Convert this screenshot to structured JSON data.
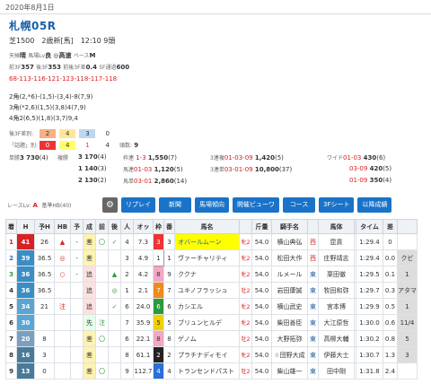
{
  "header": {
    "date": "2020年8月1日"
  },
  "race": {
    "title": "札幌05R",
    "info": "芝1500　2歳新[馬]　12:10 9頭",
    "weather_line": {
      "tenki_label": "天候",
      "tenki": "晴",
      "baba_label": "馬場Lv",
      "baba": "良",
      "baba_mark": "◎",
      "speed": "高速",
      "pace_label": "ペース",
      "pace": "M"
    },
    "time_line": {
      "zen3f_label": "前3F",
      "zen3f": "357",
      "kou3f_label": "後3F",
      "kou3f": "353",
      "diff_label": "前後3F差",
      "diff": "0.4",
      "f5_label": "5F通過",
      "f5": "600"
    },
    "laps": "68-113-116-121-123-118-117-118",
    "corners": [
      "2角(2,*6)-(1,5)-(3,4)-8(7,9)",
      "3角(*2,6)(1,5)(3,8)4(7,9)",
      "4角2(6,5)(1,8)(3,7)9,4"
    ],
    "kyaku": {
      "label": "後3F差別:",
      "values": [
        "2",
        "4",
        "3",
        "0"
      ]
    },
    "shiro": {
      "label": "「話題」別:",
      "values": [
        "0",
        "4",
        "1",
        "4"
      ],
      "count_label": "頭数:",
      "count": "9"
    }
  },
  "payouts": {
    "tansho": {
      "label": "単勝",
      "num": "3",
      "pay": "730",
      "pop": "(4)"
    },
    "fukusho_label": "複勝",
    "fukusho": [
      {
        "num": "3",
        "pay": "170",
        "pop": "(4)"
      },
      {
        "num": "1",
        "pay": "140",
        "pop": "(3)"
      },
      {
        "num": "2",
        "pay": "130",
        "pop": "(2)"
      }
    ],
    "wakuren": {
      "label": "枠連",
      "num": "1-3",
      "pay": "1,550",
      "pop": "(7)"
    },
    "umaren": {
      "label": "馬連",
      "num": "01-03",
      "pay": "1,120",
      "pop": "(5)"
    },
    "umatan": {
      "label": "馬単",
      "num": "03-01",
      "pay": "2,860",
      "pop": "(14)"
    },
    "renpuku": {
      "label": "3連複",
      "num": "01-03-09",
      "pay": "1,420",
      "pop": "(5)"
    },
    "rentan": {
      "label": "3連単",
      "num": "03-01-09",
      "pay": "10,800",
      "pop": "(37)"
    },
    "wide_label": "ワイド",
    "wide": [
      {
        "num": "01-03",
        "pay": "430",
        "pop": "(6)"
      },
      {
        "num": "03-09",
        "pay": "420",
        "pop": "(5)"
      },
      {
        "num": "01-09",
        "pay": "350",
        "pop": "(4)"
      }
    ]
  },
  "race_lv": {
    "label": "レースLv:",
    "value": "A",
    "base_label": "基準HB(40)"
  },
  "toolbar": {
    "buttons": [
      "リプレイ",
      "新聞",
      "馬場傾向",
      "開催ビューワ",
      "コース",
      "3Fシート",
      "以降成績"
    ]
  },
  "table": {
    "headers": [
      "着",
      "H",
      "予H",
      "HB",
      "予",
      "成",
      "前",
      "後",
      "人",
      "オッ",
      "枠",
      "番",
      "馬名",
      "",
      "斤量",
      "騎手名",
      "",
      "馬体",
      "",
      "タイム",
      "差",
      ""
    ],
    "rows": [
      {
        "chaku": "1",
        "h": "41",
        "yoh": "26",
        "hb": "▲",
        "yo": "-",
        "sei": "差",
        "mae": "〇",
        "ato": "✓",
        "nin": "4",
        "odds": "7.3",
        "waku": "3",
        "ban": "3",
        "name": "オバールムーン",
        "sex": "牝2",
        "kin": "54.0",
        "jockey": "横山典弘",
        "loc": "西",
        "trainer": "昆貢",
        "time": "1:29.4",
        "sa": "0",
        "extra": ""
      },
      {
        "chaku": "2",
        "h": "39",
        "yoh": "36.5",
        "hb": "◎",
        "yo": "-",
        "sei": "差",
        "mae": "",
        "ato": "",
        "nin": "3",
        "odds": "4.9",
        "waku": "1",
        "ban": "1",
        "name": "ヴァーチャリティ",
        "sex": "牝2",
        "kin": "54.0",
        "jockey": "松田大作",
        "loc": "西",
        "trainer": "庄野靖志",
        "time": "1:29.4",
        "sa": "0.0",
        "extra": "クビ"
      },
      {
        "chaku": "3",
        "h": "36",
        "yoh": "36.5",
        "hb": "○",
        "yo": "-",
        "sei": "追",
        "mae": "",
        "ato": "▲",
        "nin": "2",
        "odds": "4.2",
        "waku": "8",
        "ban": "9",
        "name": "ククナ",
        "sex": "牝2",
        "kin": "54.0",
        "jockey": "ルメール",
        "loc": "東",
        "trainer": "栗田徹",
        "time": "1:29.5",
        "sa": "0.1",
        "extra": "1"
      },
      {
        "chaku": "4",
        "h": "36",
        "yoh": "36.5",
        "hb": "",
        "yo": "",
        "sei": "追",
        "mae": "",
        "ato": "◎",
        "nin": "1",
        "odds": "2.1",
        "waku": "7",
        "ban": "7",
        "name": "ユキノフラッシュ",
        "sex": "牡2",
        "kin": "54.0",
        "jockey": "岩田康誠",
        "loc": "東",
        "trainer": "牧田和弥",
        "time": "1:29.7",
        "sa": "0.3",
        "extra": "アタマ"
      },
      {
        "chaku": "5",
        "h": "34",
        "yoh": "21",
        "hb": "注",
        "yo": "",
        "sei": "追",
        "mae": "",
        "ato": "✓",
        "nin": "6",
        "odds": "24.0",
        "waku": "6",
        "ban": "6",
        "name": "カシエル",
        "sex": "牝2",
        "kin": "54.0",
        "jockey": "横山武史",
        "loc": "東",
        "trainer": "宮本博",
        "time": "1:29.9",
        "sa": "0.5",
        "extra": "1"
      },
      {
        "chaku": "6",
        "h": "30",
        "yoh": "",
        "hb": "",
        "yo": "",
        "sei": "先",
        "mae": "注",
        "ato": "",
        "nin": "7",
        "odds": "35.9",
        "waku": "5",
        "ban": "5",
        "name": "ブリュンヒルデ",
        "sex": "牝2",
        "kin": "54.0",
        "jockey": "柴田善臣",
        "loc": "東",
        "trainer": "大江原哲",
        "time": "1:30.0",
        "sa": "0.6",
        "extra": "11/4"
      },
      {
        "chaku": "7",
        "h": "20",
        "yoh": "8",
        "hb": "",
        "yo": "",
        "sei": "差",
        "mae": "〇",
        "ato": "",
        "nin": "6",
        "odds": "22.1",
        "waku": "8",
        "ban": "8",
        "name": "ゲノム",
        "sex": "牡2",
        "kin": "54.0",
        "jockey": "大野拓弥",
        "loc": "東",
        "trainer": "高柳大輔",
        "time": "1:30.2",
        "sa": "0.8",
        "extra": "5"
      },
      {
        "chaku": "8",
        "h": "16",
        "yoh": "3",
        "hb": "",
        "yo": "",
        "sei": "差",
        "mae": "",
        "ato": "",
        "nin": "8",
        "odds": "61.1",
        "waku": "2",
        "ban": "2",
        "name": "プラチナディモイ",
        "sex": "牝2",
        "kin": "54.0",
        "jockey": "☆団野大成",
        "loc": "東",
        "trainer": "伊藤大士",
        "time": "1:30.7",
        "sa": "1.3",
        "extra": "3"
      },
      {
        "chaku": "9",
        "h": "13",
        "yoh": "0",
        "hb": "",
        "yo": "",
        "sei": "差",
        "mae": "〇",
        "ato": "",
        "nin": "9",
        "odds": "112.7",
        "waku": "4",
        "ban": "4",
        "name": "トランセンドパスト",
        "sex": "牡2",
        "kin": "54.0",
        "jockey": "柴山雄一",
        "loc": "東",
        "trainer": "田中剛",
        "time": "1:31.8",
        "sa": "2.4",
        "extra": ""
      }
    ]
  },
  "colors": {
    "accent": "#1a73c8",
    "title": "#1a5fa8",
    "highlight": "#ffff00"
  }
}
